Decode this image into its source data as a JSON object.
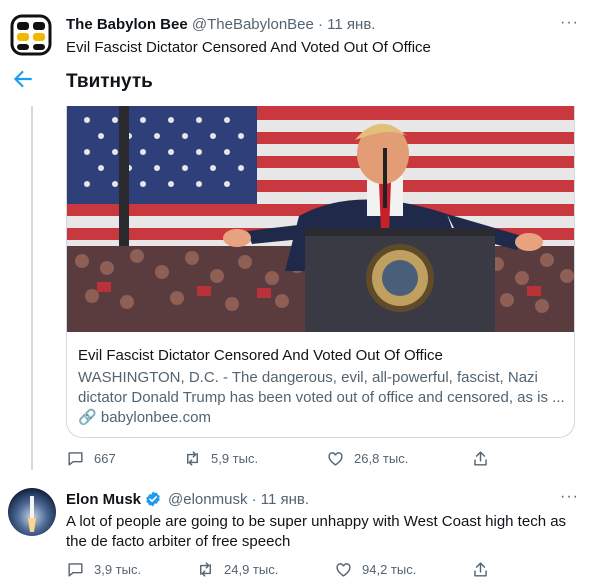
{
  "quoted_header": {
    "name": "The Babylon Bee",
    "handle_date": "@TheBabylonBee · 11 янв.",
    "text": "Evil Fascist Dictator Censored And Voted Out Of Office"
  },
  "topbar": {
    "title": "Твитнуть"
  },
  "card": {
    "title": "Evil Fascist Dictator Censored And Voted Out Of Office",
    "description": "WASHINGTON, D.C. - The dangerous, evil, all-powerful, fascist, Nazi dictator Donald Trump has been voted out of office and censored, as is ...",
    "link": "babylonbee.com"
  },
  "tweet1_actions": {
    "replies": "667",
    "retweets": "5,9 тыс.",
    "likes": "26,8 тыс."
  },
  "tweet2": {
    "name": "Elon Musk",
    "handle_date": "@elonmusk · 11 янв.",
    "text": "A lot of people are going to be super unhappy with West Coast high tech as the de facto arbiter of free speech",
    "replies": "3,9 тыс.",
    "retweets": "24,9 тыс.",
    "likes": "94,2 тыс."
  },
  "colors": {
    "accent": "#1d9bf0",
    "muted": "#536471",
    "border": "#cfd9de"
  },
  "icons": [
    "bee-logo",
    "back-arrow-icon",
    "more-icon",
    "link-icon",
    "reply-icon",
    "retweet-icon",
    "like-icon",
    "share-icon",
    "verified-icon"
  ]
}
